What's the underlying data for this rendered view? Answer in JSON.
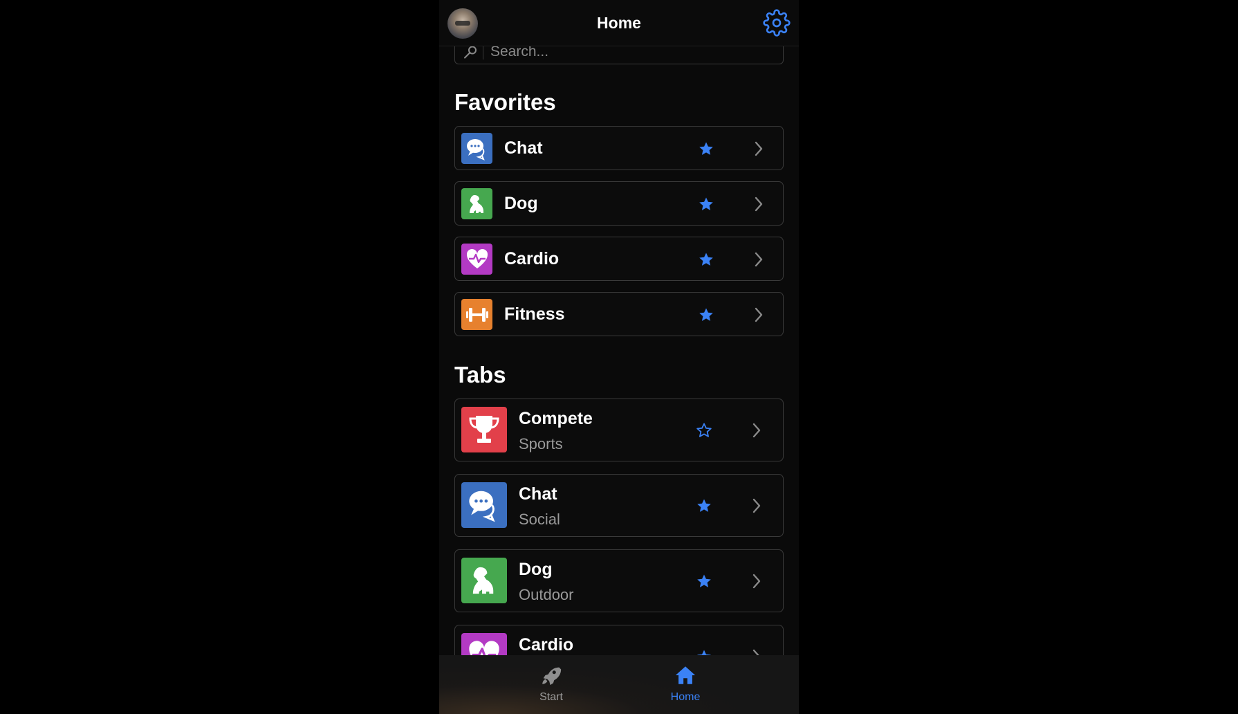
{
  "header": {
    "title": "Home"
  },
  "search": {
    "placeholder": "Search..."
  },
  "favorites": {
    "title": "Favorites",
    "items": [
      {
        "label": "Chat",
        "icon": "chat-icon",
        "color": "#3b6fc0",
        "starred": true
      },
      {
        "label": "Dog",
        "icon": "dog-icon",
        "color": "#46a84f",
        "starred": true
      },
      {
        "label": "Cardio",
        "icon": "heart-pulse-icon",
        "color": "#b33ac4",
        "starred": true
      },
      {
        "label": "Fitness",
        "icon": "dumbbell-icon",
        "color": "#e7812e",
        "starred": true
      }
    ]
  },
  "tabs": {
    "title": "Tabs",
    "items": [
      {
        "label": "Compete",
        "sub": "Sports",
        "icon": "trophy-icon",
        "color": "#e2404a",
        "starred": false
      },
      {
        "label": "Chat",
        "sub": "Social",
        "icon": "chat-icon",
        "color": "#3b6fc0",
        "starred": true
      },
      {
        "label": "Dog",
        "sub": "Outdoor",
        "icon": "dog-icon",
        "color": "#46a84f",
        "starred": true
      },
      {
        "label": "Cardio",
        "sub": "",
        "icon": "heart-pulse-icon",
        "color": "#b33ac4",
        "starred": true
      }
    ]
  },
  "bottom_nav": {
    "start_label": "Start",
    "home_label": "Home",
    "active": "Home"
  },
  "colors": {
    "accent": "#3b82f6",
    "background": "#0a0a0a",
    "border": "#3a3a3a"
  }
}
